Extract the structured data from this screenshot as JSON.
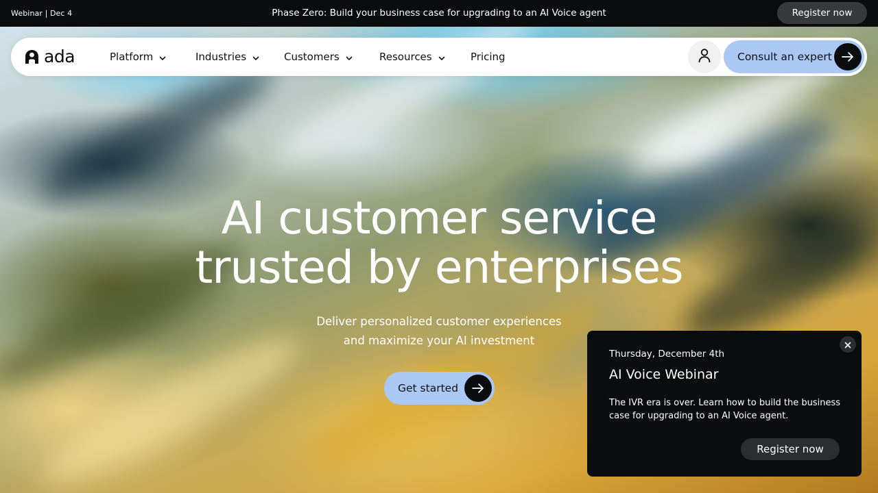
{
  "announcement": {
    "tag": "Webinar | Dec 4",
    "message": "Phase Zero: Build your business case for upgrading to an AI Voice agent",
    "register_label": "Register now"
  },
  "nav": {
    "logo_text": "ada",
    "logo_icon": "ada-logo-icon",
    "items": [
      {
        "label": "Platform",
        "icon": "chevron-down-icon"
      },
      {
        "label": "Industries",
        "icon": "chevron-down-icon"
      },
      {
        "label": "Customers",
        "icon": "chevron-down-icon"
      },
      {
        "label": "Resources",
        "icon": "chevron-down-icon"
      },
      {
        "label": "Pricing"
      }
    ],
    "account_icon": "user-icon",
    "cta_label": "Consult an expert",
    "cta_icon": "arrow-right-icon"
  },
  "hero": {
    "headline_line1": "AI customer service",
    "headline_line2": "trusted by enterprises",
    "subtitle_line1": "Deliver personalized customer experiences",
    "subtitle_line2": "and maximize your AI investment",
    "cta_label": "Get started",
    "cta_icon": "arrow-right-icon"
  },
  "popup": {
    "date": "Thursday, December 4th",
    "title": "AI Voice Webinar",
    "description": "The IVR era is over. Learn how to build the business case for upgrading to an AI Voice agent.",
    "register_label": "Register now",
    "close_icon": "close-icon"
  },
  "colors": {
    "accent_button": "#abc8f5",
    "dark": "#0b0c0e",
    "dark_button": "#38393c"
  }
}
